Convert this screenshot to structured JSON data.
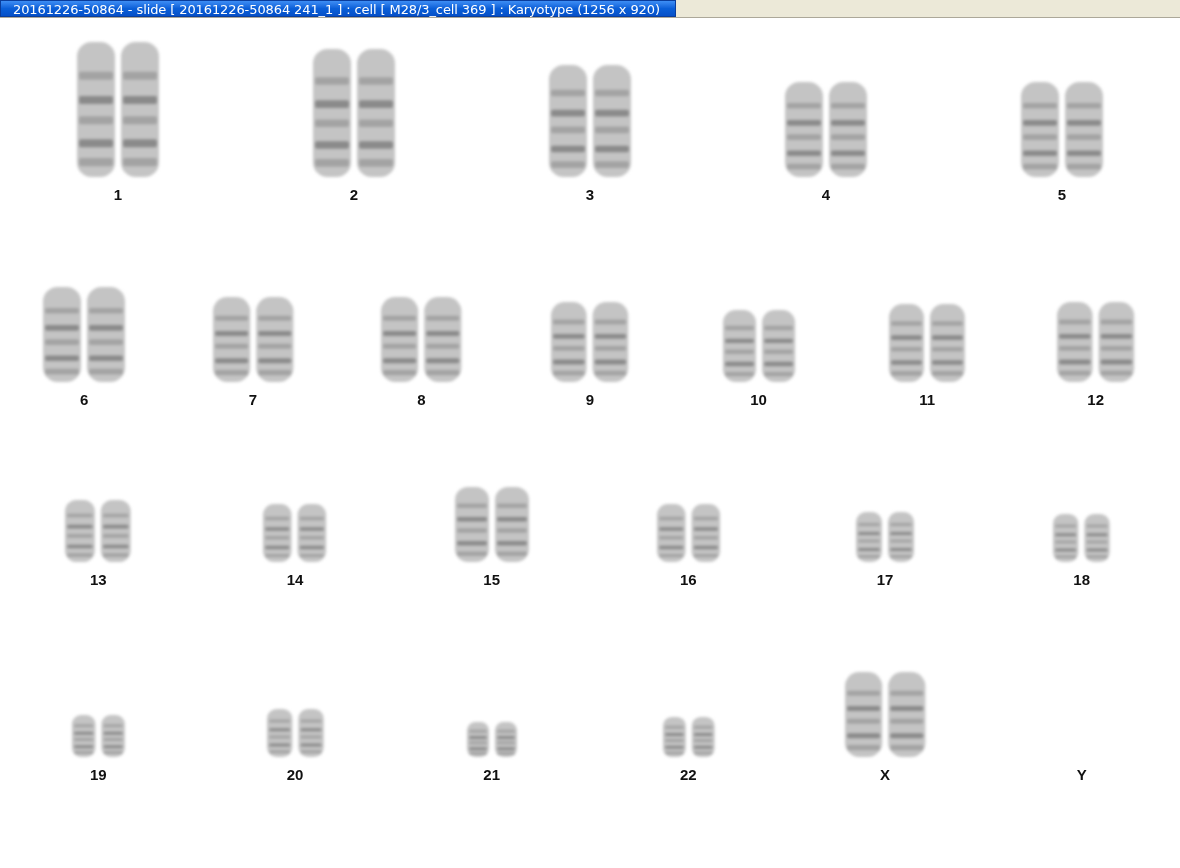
{
  "window": {
    "title": "20161226-50864 - slide [ 20161226-50864 241_1 ] : cell [ M28/3_cell 369 ] : Karyotype  (1256 x 920)"
  },
  "karyotype": {
    "rows": [
      {
        "items": [
          {
            "label": "1",
            "present": true
          },
          {
            "label": "2",
            "present": true
          },
          {
            "label": "3",
            "present": true
          },
          {
            "label": "4",
            "present": true
          },
          {
            "label": "5",
            "present": true
          }
        ]
      },
      {
        "items": [
          {
            "label": "6",
            "present": true
          },
          {
            "label": "7",
            "present": true
          },
          {
            "label": "8",
            "present": true
          },
          {
            "label": "9",
            "present": true
          },
          {
            "label": "10",
            "present": true
          },
          {
            "label": "11",
            "present": true
          },
          {
            "label": "12",
            "present": true
          }
        ]
      },
      {
        "items": [
          {
            "label": "13",
            "present": true
          },
          {
            "label": "14",
            "present": true
          },
          {
            "label": "15",
            "present": true
          },
          {
            "label": "16",
            "present": true
          },
          {
            "label": "17",
            "present": true
          },
          {
            "label": "18",
            "present": true
          }
        ]
      },
      {
        "items": [
          {
            "label": "19",
            "present": true
          },
          {
            "label": "20",
            "present": true
          },
          {
            "label": "21",
            "present": true
          },
          {
            "label": "22",
            "present": true
          },
          {
            "label": "X",
            "present": true
          },
          {
            "label": "Y",
            "present": false
          }
        ]
      }
    ]
  }
}
